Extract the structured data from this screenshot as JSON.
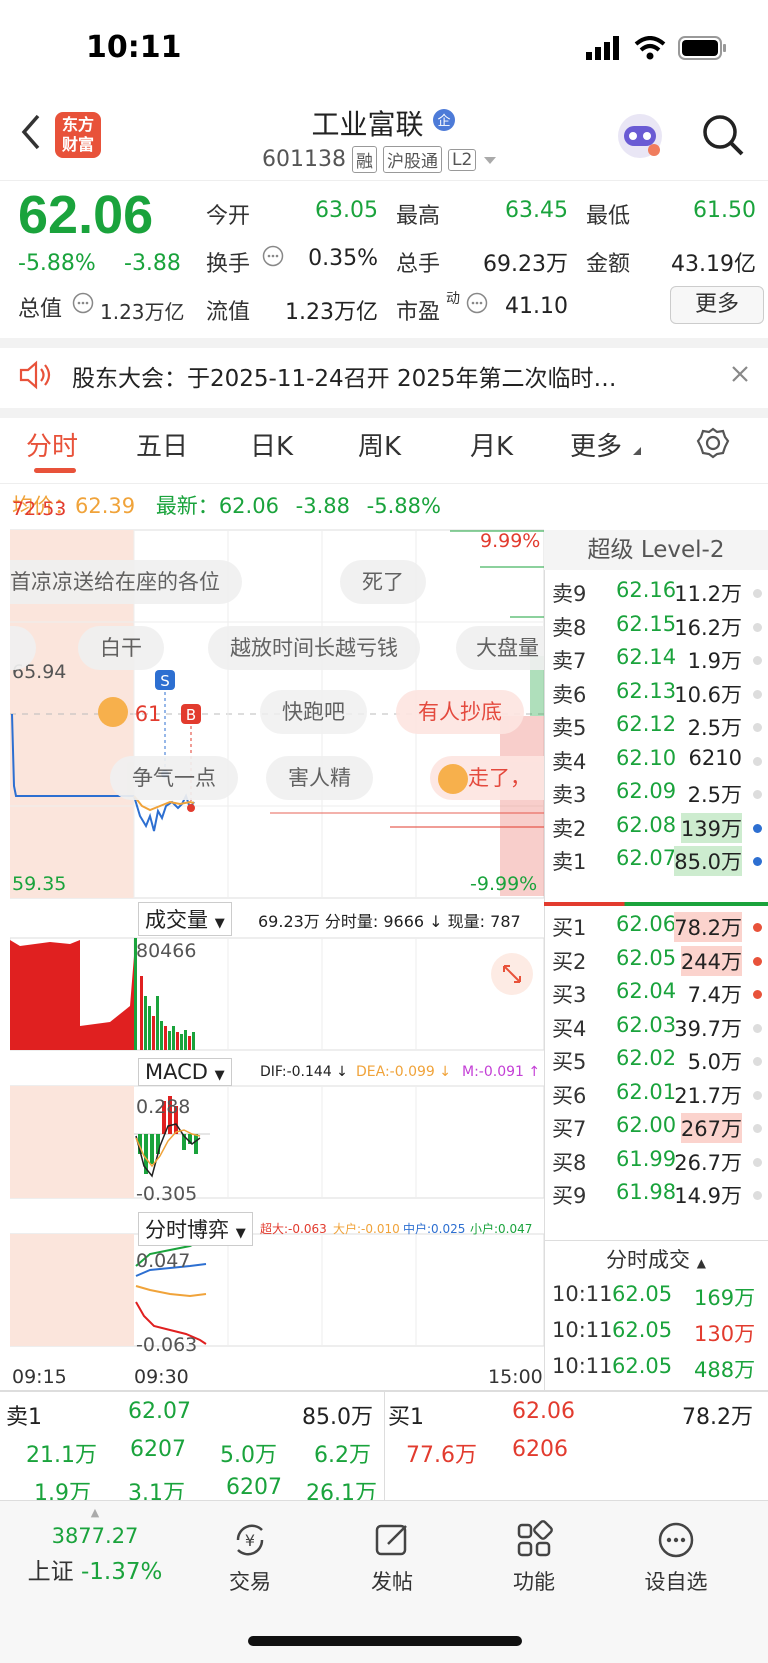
{
  "status_bar": {
    "time": "10:11"
  },
  "header": {
    "stock_name": "工业富联",
    "stock_code": "601138",
    "tags": [
      "融",
      "沪股通",
      "L2"
    ],
    "logo_text": [
      "东方",
      "财富"
    ]
  },
  "quote": {
    "price": "62.06",
    "change_pct": "-5.88%",
    "change": "-3.88",
    "fields": [
      {
        "label": "今开",
        "value": "63.05"
      },
      {
        "label": "最高",
        "value": "63.45"
      },
      {
        "label": "最低",
        "value": "61.50"
      },
      {
        "label": "换手",
        "value": "0.35%"
      },
      {
        "label": "总手",
        "value": "69.23万"
      },
      {
        "label": "金额",
        "value": "43.19亿"
      },
      {
        "label": "流值",
        "value": "1.23万亿"
      },
      {
        "label": "市盈",
        "value": "41.10"
      }
    ],
    "market_cap_label": "总值",
    "market_cap": "1.23万亿",
    "pe_superscript": "动",
    "more_label": "更多"
  },
  "notice": {
    "text": "股东大会：于2025-11-24召开 2025年第二次临时…"
  },
  "tabs": [
    "分时",
    "五日",
    "日K",
    "周K",
    "月K",
    "更多"
  ],
  "avg_bar": {
    "avg_label": "均价：",
    "avg": "62.39",
    "latest_label": "最新：",
    "latest": "62.06",
    "chg": "-3.88",
    "pct": "-5.88%"
  },
  "chart": {
    "y_top": "72.53",
    "y_mid": "65.94",
    "y_bottom": "59.35",
    "pct_top": "9.99%",
    "pct_bottom": "-9.99%",
    "marker_s": "S",
    "marker_b": "B",
    "badge": "61",
    "chips": [
      "首凉凉送给在座的各位",
      "死了",
      "白干",
      "越放时间长越亏钱",
      "大盘量",
      "快跑吧",
      "有人抄底",
      "争气一点",
      "害人精",
      "走了，"
    ],
    "volume_label": "成交量",
    "volume_info": "69.23万 分时量: 9666 ↓ 现量: 787",
    "volume_max": "80466",
    "macd_label": "MACD",
    "macd_dif": "DIF:-0.144 ↓",
    "macd_dea": "DEA:-0.099 ↓",
    "macd_m": "M:-0.091 ↑",
    "macd_top": "0.288",
    "macd_bottom": "-0.305",
    "game_label": "分时博弈",
    "game_super": "超大:-0.063",
    "game_big": "大户:-0.010",
    "game_mid": "中户:0.025",
    "game_small": "小户:0.047",
    "game_top": "0.047",
    "game_bottom": "-0.063",
    "time_start": "09:15",
    "time_open": "09:30",
    "time_end": "15:00"
  },
  "level2": {
    "title": "超级 Level-2",
    "asks": [
      {
        "label": "卖9",
        "price": "62.16",
        "vol": "11.2万"
      },
      {
        "label": "卖8",
        "price": "62.15",
        "vol": "16.2万"
      },
      {
        "label": "卖7",
        "price": "62.14",
        "vol": "1.9万"
      },
      {
        "label": "卖6",
        "price": "62.13",
        "vol": "10.6万"
      },
      {
        "label": "卖5",
        "price": "62.12",
        "vol": "2.5万"
      },
      {
        "label": "卖4",
        "price": "62.10",
        "vol": "6210"
      },
      {
        "label": "卖3",
        "price": "62.09",
        "vol": "2.5万"
      },
      {
        "label": "卖2",
        "price": "62.08",
        "vol": "139万"
      },
      {
        "label": "卖1",
        "price": "62.07",
        "vol": "85.0万"
      }
    ],
    "bids": [
      {
        "label": "买1",
        "price": "62.06",
        "vol": "78.2万"
      },
      {
        "label": "买2",
        "price": "62.05",
        "vol": "244万"
      },
      {
        "label": "买3",
        "price": "62.04",
        "vol": "7.4万"
      },
      {
        "label": "买4",
        "price": "62.03",
        "vol": "39.7万"
      },
      {
        "label": "买5",
        "price": "62.02",
        "vol": "5.0万"
      },
      {
        "label": "买6",
        "price": "62.01",
        "vol": "21.7万"
      },
      {
        "label": "买7",
        "price": "62.00",
        "vol": "267万"
      },
      {
        "label": "买8",
        "price": "61.99",
        "vol": "26.7万"
      },
      {
        "label": "买9",
        "price": "61.98",
        "vol": "14.9万"
      }
    ],
    "ticks_title": "分时成交",
    "ticks": [
      {
        "time": "10:11",
        "price": "62.05",
        "vol": "169万",
        "color": "#1aa33c"
      },
      {
        "time": "10:11",
        "price": "62.05",
        "vol": "130万",
        "color": "#e23b2e"
      },
      {
        "time": "10:11",
        "price": "62.05",
        "vol": "488万",
        "color": "#1aa33c"
      }
    ]
  },
  "queue": {
    "ask_label": "卖1",
    "ask_price": "62.07",
    "ask_total": "85.0万",
    "bid_label": "买1",
    "bid_price": "62.06",
    "bid_total": "78.2万",
    "ask_row1": [
      "21.1万",
      "6207",
      "5.0万",
      "6.2万"
    ],
    "ask_row2": [
      "1.9万",
      "3.1万",
      "6207",
      "26.1万"
    ],
    "bid_row1": [
      "77.6万",
      "6206"
    ]
  },
  "tabbar": {
    "index_value": "3877.27",
    "index_name": "上证",
    "index_pct": "-1.37%",
    "items": [
      "交易",
      "发帖",
      "功能",
      "设自选"
    ]
  },
  "colors": {
    "up": "#e23b2e",
    "down": "#1aa33c",
    "accent": "#e8523a",
    "avg": "#f0a33a"
  }
}
